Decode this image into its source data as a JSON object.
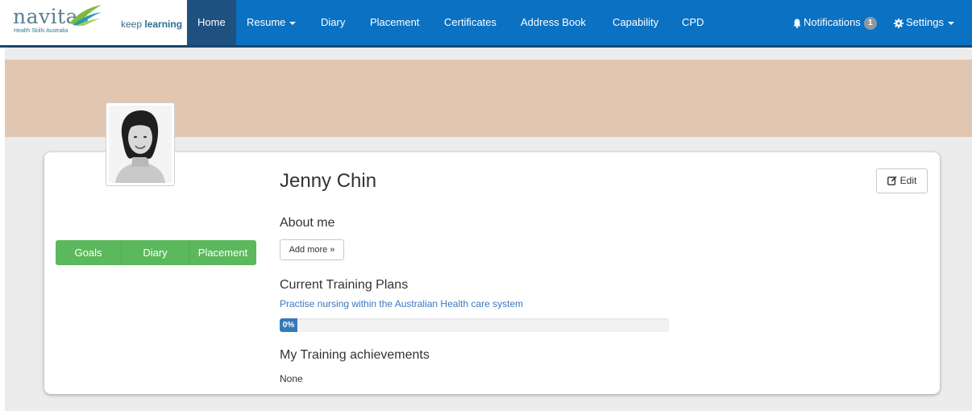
{
  "brand": {
    "name": "navitas",
    "subtitle": "Health Skills Australia",
    "tagline_1": "keep ",
    "tagline_2": "learning"
  },
  "nav": {
    "items": [
      {
        "label": "Home",
        "active": true
      },
      {
        "label": "Resume",
        "dropdown": true
      },
      {
        "label": "Diary"
      },
      {
        "label": "Placement"
      },
      {
        "label": "Certificates"
      },
      {
        "label": "Address Book"
      },
      {
        "label": "Capability"
      },
      {
        "label": "CPD"
      }
    ],
    "notifications": {
      "label": "Notifications",
      "count": "1",
      "icon": "bell-icon"
    },
    "settings": {
      "label": "Settings",
      "icon": "gear-icon"
    }
  },
  "profile": {
    "name": "Jenny Chin",
    "edit_label": "Edit",
    "buttons": [
      "Goals",
      "Diary",
      "Placement"
    ],
    "about_title": "About me",
    "add_more_label": "Add more »",
    "plans_title": "Current Training Plans",
    "plan_name": "Practise nursing within the Australian Health care system",
    "plan_progress_label": "0%",
    "plan_progress_value": 0,
    "achievements_title": "My Training achievements",
    "achievements_value": "None"
  },
  "colors": {
    "navbar": "#0b71c2",
    "nav_active": "#1e517f",
    "cover": "#e1c7b1",
    "green": "#5cb85c",
    "progress": "#337ab7"
  }
}
